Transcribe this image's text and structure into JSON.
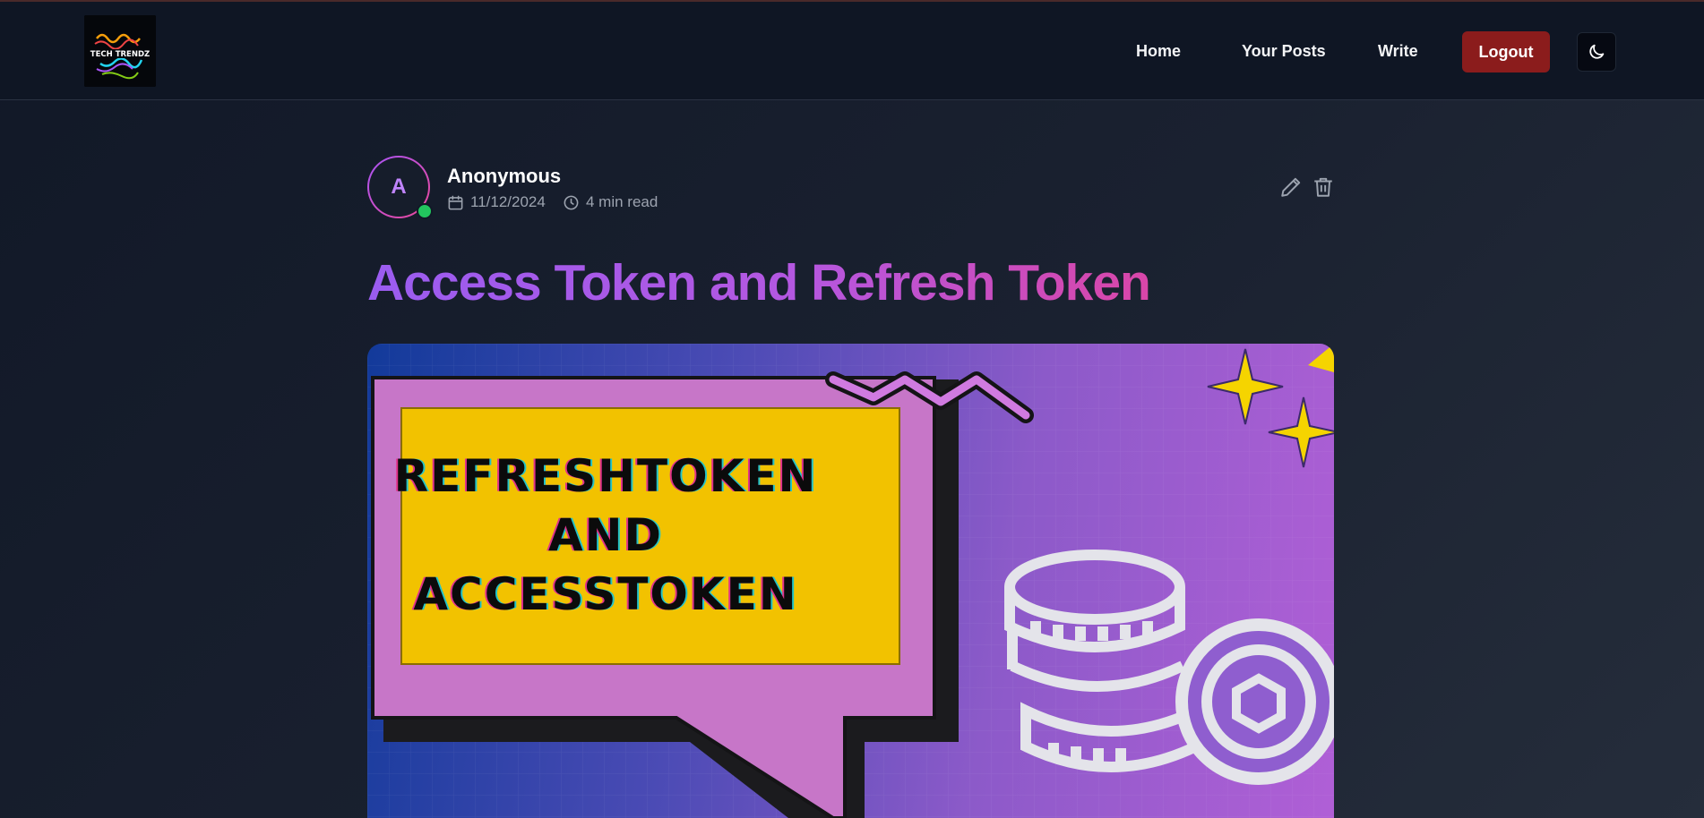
{
  "nav": {
    "logo_alt": "TECH TRENDZ",
    "home": "Home",
    "your_posts": "Your Posts",
    "write": "Write",
    "logout": "Logout"
  },
  "post": {
    "author_initial": "A",
    "author_name": "Anonymous",
    "date": "11/12/2024",
    "read_time": "4 min read",
    "title": "Access Token and Refresh Token"
  },
  "hero_image": {
    "lines": [
      "REFRESHTOKEN",
      "AND",
      "ACCESSTOKEN"
    ]
  },
  "colors": {
    "accent": "#a855f7",
    "logout": "#8b1c1c",
    "online": "#22c55e"
  },
  "icons": {
    "theme": "moon-icon",
    "date": "calendar-icon",
    "time": "clock-icon",
    "edit": "pencil-icon",
    "delete": "trash-icon"
  }
}
